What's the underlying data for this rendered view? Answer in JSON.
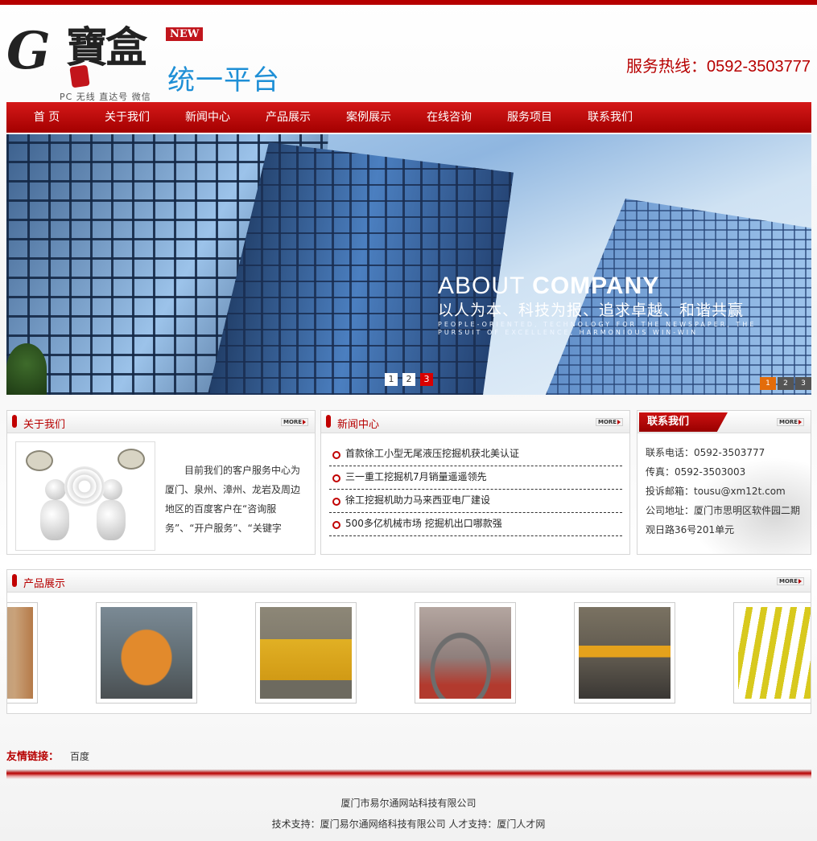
{
  "header": {
    "logo_cn": "寶盒",
    "logo_badge": "NEW",
    "logo_sub": "统一平台",
    "logo_tag": "PC 无线  直达号  微信",
    "hotline": "服务热线：0592-3503777"
  },
  "nav": [
    "首 页",
    "关于我们",
    "新闻中心",
    "产品展示",
    "案例展示",
    "在线咨询",
    "服务项目",
    "联系我们"
  ],
  "banner": {
    "title_light": "ABOUT",
    "title_bold": "COMPANY",
    "slogan": "以人为本、科技为报、追求卓越、和谐共赢",
    "slogan_en": "PEOPLE-ORIENTED, TECHNOLOGY FOR THE NEWSPAPER, THE PURSUIT OF EXCELLENCE, HARMONIOUS WIN-WIN",
    "dots": [
      "1",
      "2",
      "3"
    ],
    "active_dot": 3,
    "thumbs": [
      "1",
      "2",
      "3"
    ],
    "active_thumb": 1
  },
  "about": {
    "title": "关于我们",
    "more": "MORE",
    "text": "目前我们的客户服务中心为厦门、泉州、漳州、龙岩及周边地区的百度客户在“咨询服务”、“开户服务”、“关键字"
  },
  "news": {
    "title": "新闻中心",
    "more": "MORE",
    "items": [
      "首款徐工小型无尾液压挖掘机获北美认证",
      "三一重工挖掘机7月销量遥遥领先",
      "徐工挖掘机助力马来西亚电厂建设",
      "500多亿机械市场 挖掘机出口哪款强"
    ]
  },
  "contact": {
    "title": "联系我们",
    "more": "MORE",
    "lines": [
      "联系电话：0592-3503777",
      "传真：0592-3503003",
      "投诉邮箱：tousu@xm12t.com",
      "公司地址：厦门市思明区软件园二期观日路36号201单元"
    ]
  },
  "products": {
    "title": "产品展示",
    "more": "MORE"
  },
  "links": {
    "label": "友情链接：",
    "items": [
      "百度"
    ]
  },
  "footer": {
    "company": "厦门市易尔通网站科技有限公司",
    "support": "技术支持：厦门易尔通网络科技有限公司 人才支持：厦门人才网"
  },
  "colors": {
    "brand_red": "#b70000",
    "accent_blue": "#1e8fd6"
  }
}
